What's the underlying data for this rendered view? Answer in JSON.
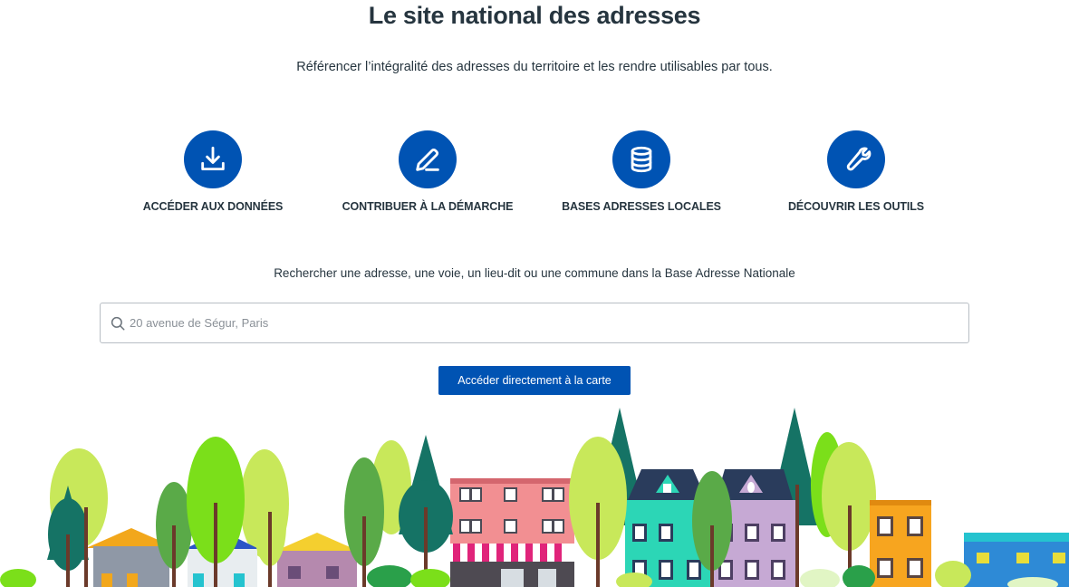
{
  "header": {
    "title": "Le site national des adresses",
    "subtitle": "Référencer l’intégralité des adresses du territoire et les rendre utilisables par tous."
  },
  "cards": [
    {
      "label": "ACCÉDER AUX DONNÉES",
      "icon": "download-icon"
    },
    {
      "label": "CONTRIBUER À LA DÉMARCHE",
      "icon": "pencil-icon"
    },
    {
      "label": "BASES ADRESSES LOCALES",
      "icon": "database-icon"
    },
    {
      "label": "DÉCOUVRIR LES OUTILS",
      "icon": "wrench-icon"
    }
  ],
  "search": {
    "help_text": "Rechercher une adresse, une voie, un lieu-dit ou une commune dans la Base Adresse Nationale",
    "placeholder": "20 avenue de Ségur, Paris",
    "value": ""
  },
  "map_button": {
    "label": "Accéder directement à la carte"
  },
  "colors": {
    "primary": "#0053b3",
    "text": "#26353f",
    "border": "#b8bec4"
  }
}
